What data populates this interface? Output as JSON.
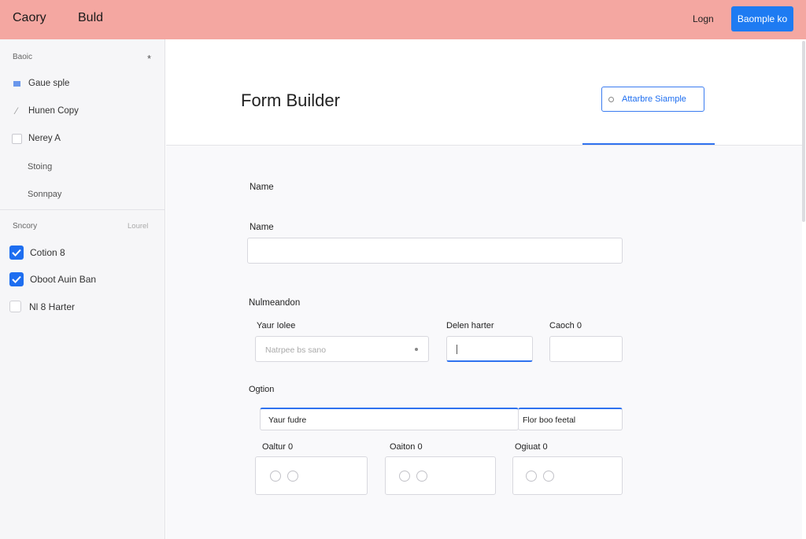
{
  "topbar": {
    "brand_primary": "Caory",
    "brand_secondary": "Buld",
    "login_label": "Logn",
    "cta_label": "Baomple ko"
  },
  "sidebar": {
    "section_title": "Baoic",
    "star_icon": "star-icon",
    "items": [
      {
        "label": "Gaue sple",
        "icon": "square-blue-icon"
      },
      {
        "label": "Hunen Copy",
        "icon": "pencil-icon"
      },
      {
        "label": "Nerey A",
        "icon": "checkbox-empty-icon"
      }
    ],
    "subitems": [
      "Stoing",
      "Sonnpay"
    ],
    "section2_title": "Sncory",
    "section2_right": "Lourel",
    "checks": [
      {
        "label": "Cotion 8",
        "checked": true
      },
      {
        "label": "Oboot Auin Ban",
        "checked": true
      },
      {
        "label": "Nl 8 Harter",
        "checked": false
      }
    ]
  },
  "main": {
    "title": "Form Builder",
    "header_button": "Attarbre Siample",
    "section_label": "Name",
    "name_label": "Name",
    "name_value": "",
    "group_label": "Nulmeandon",
    "field1_label": "Yaur Iolee",
    "field1_placeholder": "Natrpee bs sano",
    "field2_label": "Delen harter",
    "field2_value": "",
    "field3_label": "Caoch 0",
    "field3_value": "",
    "options_label": "Ogtion",
    "row_left": "Yaur fudre",
    "row_right": "Flor boo feetal",
    "radio_groups": [
      {
        "label": "Oaltur 0"
      },
      {
        "label": "Oaiton 0"
      },
      {
        "label": "Ogiuat 0"
      }
    ]
  },
  "colors": {
    "topbar": "#f4a7a1",
    "accent": "#1e7bf2",
    "sidebar_bg": "#f6f6f8"
  }
}
